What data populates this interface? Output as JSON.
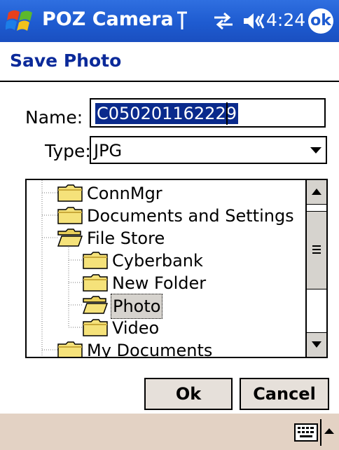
{
  "titlebar": {
    "app_title": "POZ Camera",
    "clock": "4:24",
    "ok_label": "ok",
    "icons": [
      "windows-start-icon",
      "antenna-icon",
      "sync-icon",
      "volume-icon"
    ]
  },
  "dialog": {
    "title": "Save Photo",
    "name_label": "Name:",
    "name_value": "C050201162229",
    "type_label": "Type:",
    "type_value": "JPG"
  },
  "tree": {
    "items": [
      {
        "label": "ConnMgr",
        "level": 1,
        "state": "closed"
      },
      {
        "label": "Documents and Settings",
        "level": 1,
        "state": "closed"
      },
      {
        "label": "File Store",
        "level": 1,
        "state": "open"
      },
      {
        "label": "Cyberbank",
        "level": 2,
        "state": "closed"
      },
      {
        "label": "New Folder",
        "level": 2,
        "state": "closed"
      },
      {
        "label": "Photo",
        "level": 2,
        "state": "open",
        "selected": true
      },
      {
        "label": "Video",
        "level": 2,
        "state": "closed"
      },
      {
        "label": "My Documents",
        "level": 1,
        "state": "closed"
      }
    ]
  },
  "buttons": {
    "ok": "Ok",
    "cancel": "Cancel"
  },
  "colors": {
    "titlebar": "#1e5bd0",
    "selection": "#0a2a8c",
    "button_face": "#e6e0da",
    "menubar": "#e3d2c4",
    "title_text": "#0b2a9a"
  }
}
